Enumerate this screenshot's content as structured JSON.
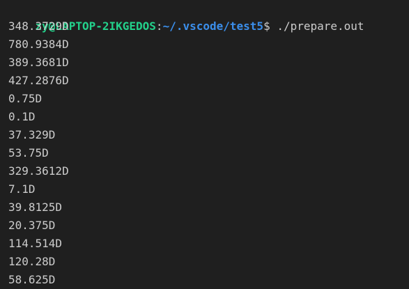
{
  "prompt": {
    "user_host": "zy@LAPTOP-2IKGEDOS",
    "colon": ":",
    "path": "~/.vscode/test5",
    "symbol": "$ ",
    "command": "./prepare.out"
  },
  "output_lines": [
    "348.3729D",
    "780.9384D",
    "389.3681D",
    "427.2876D",
    "0.75D",
    "0.1D",
    "37.329D",
    "53.75D",
    "329.3612D",
    "7.1D",
    "39.8125D",
    "20.375D",
    "114.514D",
    "120.28D",
    "58.625D"
  ],
  "colors": {
    "background": "#1f1f1f",
    "text": "#cccccc",
    "user_host": "#23d18b",
    "path": "#3b8eea"
  }
}
